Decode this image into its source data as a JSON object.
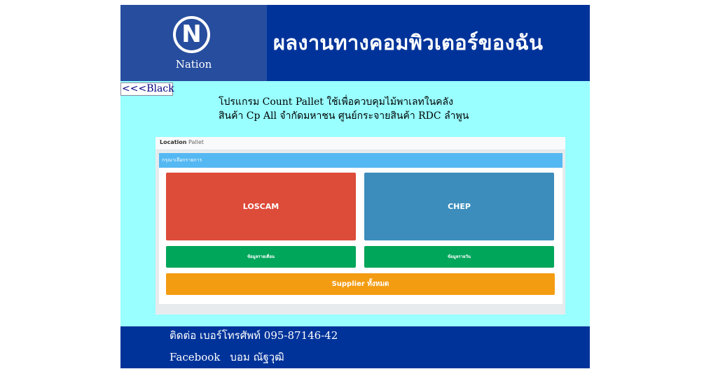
{
  "header": {
    "logo_letter": "N",
    "logo_text": "Nation",
    "title": "ผลงานทางคอมพิวเตอร์ของฉัน"
  },
  "nav": {
    "back_link": "<<<Black"
  },
  "description": {
    "line1": "โปรแกรม Count Pallet ใช้เพื่อควบคุมไม้พาเลทในคลัง",
    "line2": "สินค้า  Cp All จำกัดมหาชน ศูนย์กระจายสินค้า RDC ลำพูน"
  },
  "app": {
    "bar_title_bold": "Location",
    "bar_title_light": "Pallet",
    "panel_heading": "กรุณาเลือกรายการ",
    "tiles": {
      "loscam": "LOSCAM",
      "chep": "CHEP",
      "monthly": "ข้อมูลรายเดือน",
      "daily": "ข้อมูลรายวัน",
      "supplier": "Supplier ทั้งหมด"
    },
    "colors": {
      "loscam": "#dd4b39",
      "chep": "#3c8dbc",
      "green": "#00a65a",
      "supplier": "#f39c12",
      "panel_heading": "#54b8f2"
    }
  },
  "footer": {
    "contact": "ติดต่อ เบอร์โทรศัพท์ 095-87146-42",
    "facebook_label": "Facebook",
    "facebook_name": "บอม ณัฐวุฒิ"
  },
  "colors": {
    "header_bg": "#00339a",
    "logo_bg": "#274d9e",
    "content_bg": "#99ffff"
  }
}
